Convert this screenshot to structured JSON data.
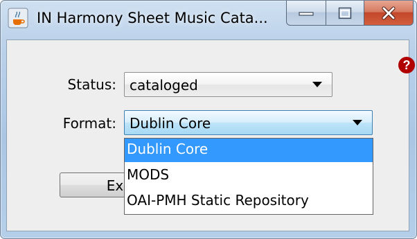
{
  "window": {
    "title": "IN Harmony Sheet Music Cata...",
    "icon": "java-cup-icon",
    "buttons": [
      "minimize",
      "maximize",
      "close"
    ]
  },
  "help": {
    "icon": "help-icon",
    "color": "#b00000"
  },
  "status": {
    "label": "Status:",
    "value": "cataloged"
  },
  "format": {
    "label": "Format:",
    "value": "Dublin Core",
    "options": [
      "Dublin Core",
      "MODS",
      "OAI-PMH Static Repository"
    ],
    "selected_index": 0
  },
  "export_button": {
    "label": "Ex"
  },
  "colors": {
    "selection": "#3399ff",
    "close_button": "#c2472a",
    "frame": "#b5cfe9"
  }
}
